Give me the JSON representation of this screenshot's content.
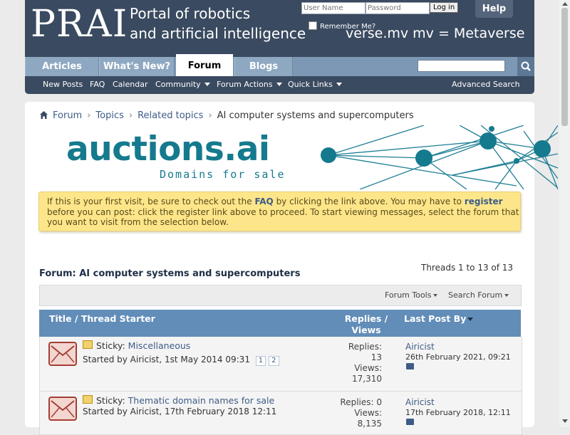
{
  "header": {
    "logo": "PRAI",
    "tagline_1": "Portal of robotics",
    "tagline_2": "and artificial intelligence",
    "username_placeholder": "User Name",
    "password_placeholder": "Password",
    "login_label": "Log in",
    "remember_label": "Remember Me?",
    "help_label": "Help",
    "tagline_right": "verse.mv mv = Metaverse"
  },
  "nav": {
    "tabs": [
      {
        "label": "Articles"
      },
      {
        "label": "What's New?"
      },
      {
        "label": "Forum"
      },
      {
        "label": "Blogs"
      }
    ],
    "active_tab": "Forum",
    "subnav": [
      {
        "label": "New Posts"
      },
      {
        "label": "FAQ"
      },
      {
        "label": "Calendar"
      },
      {
        "label": "Community"
      },
      {
        "label": "Forum Actions"
      },
      {
        "label": "Quick Links"
      }
    ],
    "advanced_search": "Advanced Search"
  },
  "breadcrumb": [
    "Forum",
    "Topics",
    "Related topics",
    "AI computer systems and supercomputers"
  ],
  "banner": {
    "name": "auctions.ai",
    "sub": "Domains for sale"
  },
  "notice": {
    "part1": "If this is your first visit, be sure to check out the ",
    "faq": "FAQ",
    "part2": " by clicking the link above. You may have to ",
    "register": "register",
    "part3": " before you can post: click the register link above to proceed. To start viewing messages, select the forum that you want to visit from the selection below."
  },
  "forum": {
    "title": "Forum: AI computer systems and supercomputers",
    "thread_count": "Threads 1 to 13 of 13",
    "tools": "Forum Tools",
    "search": "Search Forum"
  },
  "table": {
    "col_title": "Title / Thread Starter",
    "col_replies_1": "Replies /",
    "col_replies_2": "Views",
    "col_lastpost": "Last Post By"
  },
  "threads": [
    {
      "prefix": "Sticky:",
      "title": "Miscellaneous",
      "starter": "Started by Airicist, 1st May 2014 09:31",
      "pages": [
        "1",
        "2"
      ],
      "replies_label": "Replies:",
      "replies": "13",
      "views_label": "Views:",
      "views": "17,310",
      "last_user": "Airicist",
      "last_date": "26th February 2021, 09:21"
    },
    {
      "prefix": "Sticky:",
      "title": "Thematic domain names for sale",
      "starter": "Started by Airicist, 17th February 2018 12:11",
      "pages": [],
      "replies_label": "Replies: 0",
      "replies": "",
      "views_label": "Views:",
      "views": "8,135",
      "last_user": "Airicist",
      "last_date": "17th February 2018, 12:11"
    }
  ],
  "colors": {
    "header_bg": "#3a4a60",
    "nav_bg": "#7c98b4",
    "table_head": "#628db8",
    "link": "#3e5c86",
    "notice_bg": "#fde68a",
    "banner_teal": "#157a8e"
  }
}
